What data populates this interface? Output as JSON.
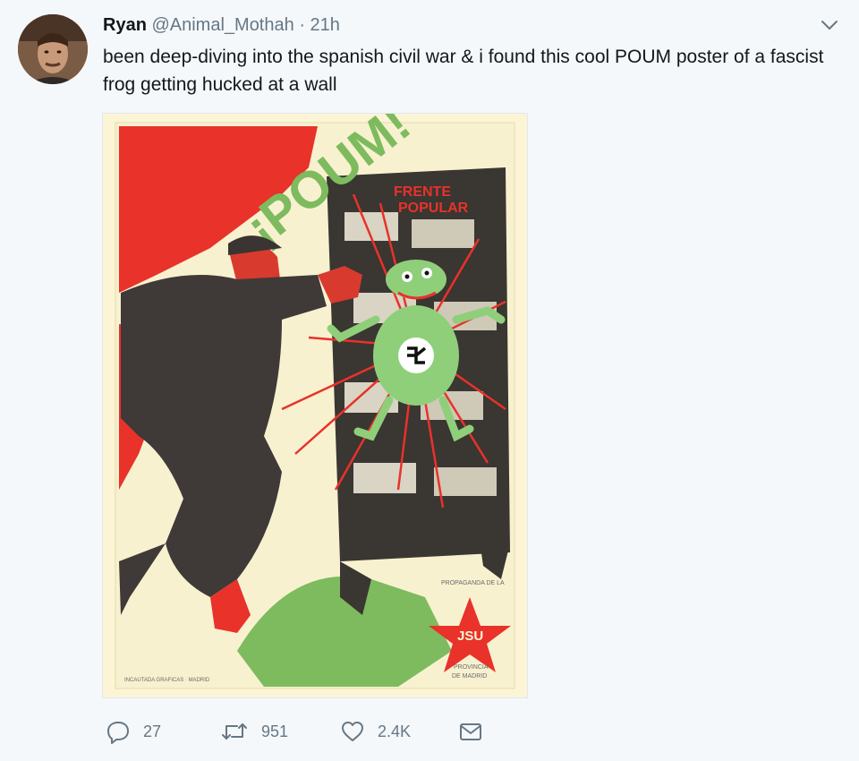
{
  "tweet": {
    "author_name": "Ryan",
    "handle": "@Animal_Mothah",
    "separator": "·",
    "time": "21h",
    "text": "been deep-diving into the spanish civil war & i found this cool POUM poster of a fascist frog getting hucked at a wall"
  },
  "media": {
    "poster_title": "¡POUM!",
    "wall_text_line1": "FRENTE",
    "wall_text_line2": "POPULAR",
    "propaganda_label": "PROPAGANDA DE LA",
    "star_text": "JSU",
    "province_line1": "PROVINCIA",
    "province_line2": "DE MADRID",
    "printer_credit": "INCAUTADA GRAFICAS · MADRID"
  },
  "actions": {
    "reply_count": "27",
    "retweet_count": "951",
    "like_count": "2.4K"
  },
  "icons": {
    "reply": "reply-icon",
    "retweet": "retweet-icon",
    "like": "heart-icon",
    "dm": "envelope-icon",
    "caret": "chevron-down-icon"
  },
  "colors": {
    "background": "#f5f8fa",
    "text": "#14171a",
    "muted": "#657786",
    "poster_red": "#e8322a",
    "poster_green": "#6fb05a",
    "poster_cream": "#fbf5d6"
  }
}
